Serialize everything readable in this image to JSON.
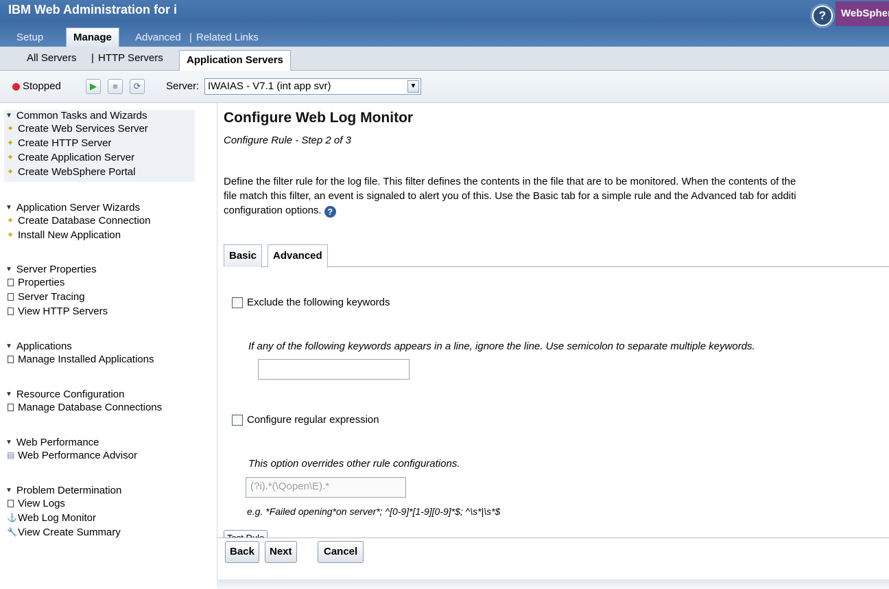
{
  "header": {
    "app_title": "IBM Web Administration for i",
    "nav_tabs": [
      "Setup",
      "Manage",
      "Advanced",
      "|",
      "Related Links"
    ],
    "brand": "WebSphere",
    "help_glyph": "?"
  },
  "sub_tabs": {
    "all_servers": "All Servers",
    "separator": "|",
    "http_servers": "HTTP Servers",
    "application_servers": "Application Servers"
  },
  "toolbar": {
    "status": "Stopped",
    "server_label": "Server:",
    "server_value": "IWAIAS - V7.1 (int app svr)",
    "status_color": "#e0242f"
  },
  "sidebar": {
    "groups": [
      {
        "title": "Common Tasks and Wizards",
        "items": [
          "Create Web Services Server",
          "Create HTTP Server",
          "Create Application Server",
          "Create WebSphere Portal"
        ]
      },
      {
        "title": "Application Server Wizards",
        "items": [
          "Create Database Connection",
          "Install New Application"
        ]
      },
      {
        "title": "Server Properties",
        "items": [
          "Properties",
          "Server Tracing",
          "View HTTP Servers"
        ]
      },
      {
        "title": "Applications",
        "items": [
          "Manage Installed Applications"
        ]
      },
      {
        "title": "Resource Configuration",
        "items": [
          "Manage Database Connections"
        ]
      },
      {
        "title": "Web Performance",
        "items": [
          "Web Performance Advisor"
        ]
      },
      {
        "title": "Problem Determination",
        "items": [
          "View Logs",
          "Web Log Monitor",
          "View Create Summary"
        ]
      }
    ]
  },
  "main": {
    "title": "Configure Web Log Monitor",
    "subtitle": "Configure Rule - Step 2 of 3",
    "description_line1": "Define the filter rule for the log file. This filter defines the contents in the file that are to be monitored. When the contents of the",
    "description_line2": "file match this filter, an event is signaled to alert you of this. Use the Basic tab for a simple rule and the Advanced tab for additi",
    "description_line3": "configuration options.",
    "tabs": {
      "basic": "Basic",
      "advanced": "Advanced"
    },
    "exclude": {
      "label": "Exclude the following keywords",
      "hint": "If any of the following keywords appears in a line, ignore the line. Use semicolon to separate multiple keywords.",
      "value": ""
    },
    "regex": {
      "label": "Configure regular expression",
      "hint": "This option overrides other rule configurations.",
      "placeholder": "(?i).*(\\Qopen\\E).*",
      "example": "e.g. *Failed opening*on server*; ^[0-9]*[1-9][0-9]*$; ^\\s*|\\s*$"
    },
    "test_rule": "Test Rule",
    "buttons": {
      "back": "Back",
      "next": "Next",
      "cancel": "Cancel"
    }
  }
}
